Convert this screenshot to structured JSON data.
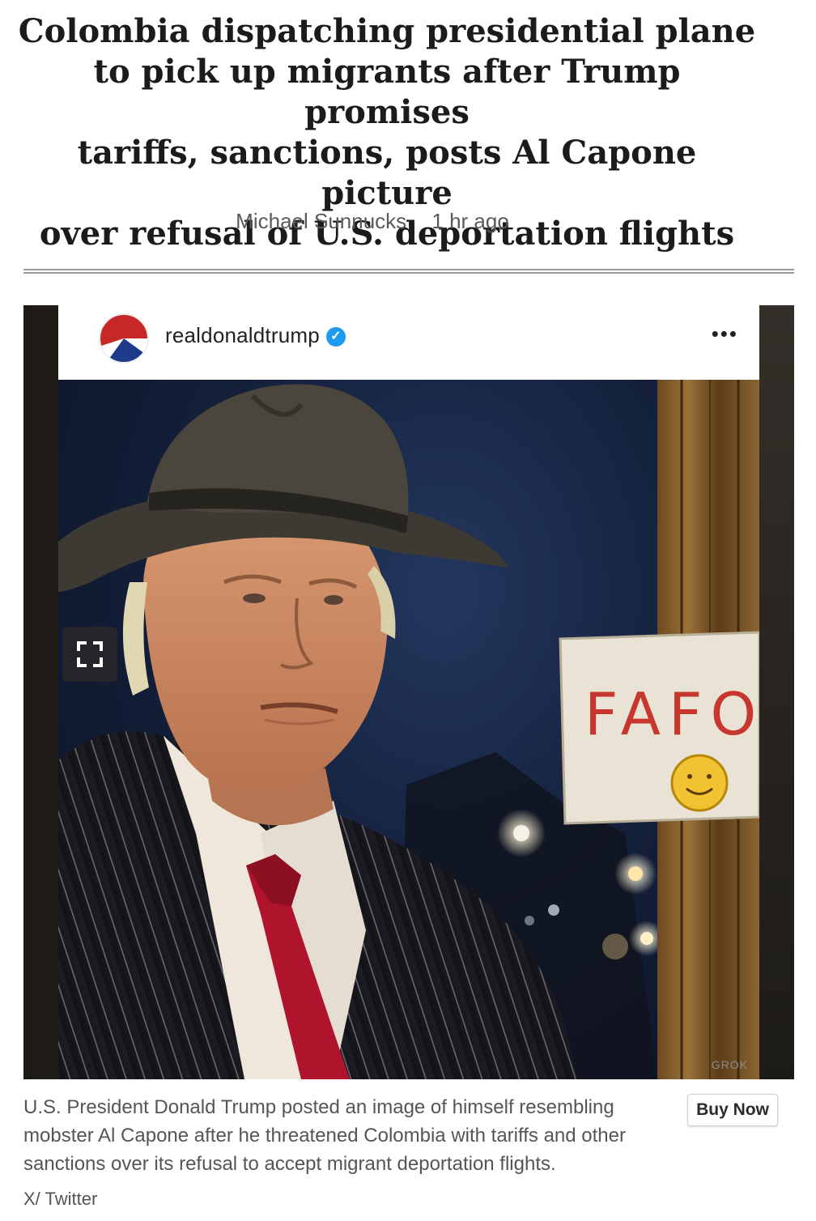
{
  "article": {
    "headline_lines": [
      "Colombia dispatching presidential plane",
      "to pick up migrants after Trump promises",
      "tariffs, sanctions, posts Al Capone picture",
      "over refusal of U.S. deportation flights"
    ],
    "author": "Michael Sunnucks",
    "published": "1 hr ago"
  },
  "post": {
    "username": "realdonaldtrump",
    "verified_glyph": "✓",
    "more_glyph": "•••",
    "sign_text": "FAFO",
    "watermark": "GROK",
    "avatar_icon": "flag-portrait-avatar",
    "expand_icon": "fullscreen-expand-icon"
  },
  "caption": {
    "text": "U.S. President Donald Trump posted an image of himself resembling mobster Al Capone after he threatened Colombia with tariffs and other sanctions over its refusal to accept migrant deportation flights.",
    "credit": "X/ Twitter",
    "buy_label": "Buy Now"
  },
  "colors": {
    "verified_blue": "#1d9bf0",
    "tie_red": "#b0142c",
    "sign_text_red": "#c8372d"
  }
}
